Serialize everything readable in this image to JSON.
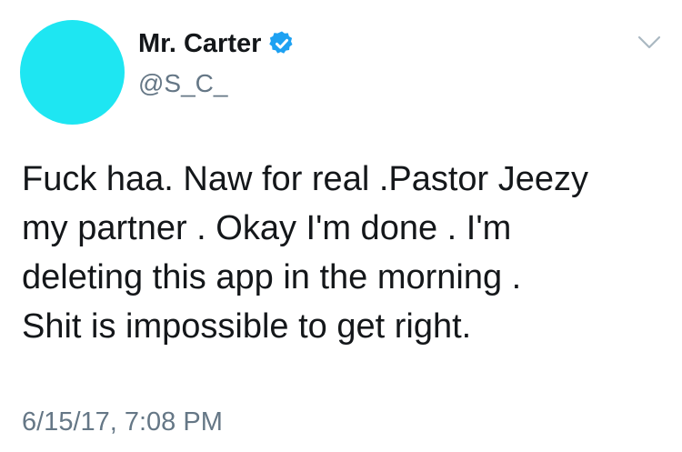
{
  "author": {
    "display_name": "Mr. Carter",
    "handle": "@S_C_",
    "verified": true,
    "avatar_color": "#1ee6f2"
  },
  "tweet": {
    "text": "Fuck haa. Naw for real .Pastor Jeezy\nmy partner . Okay I'm done . I'm\ndeleting this app in the morning .\nShit is impossible to get right.",
    "timestamp": "6/15/17, 7:08 PM"
  },
  "icons": {
    "verified": "verified-badge-icon",
    "menu": "chevron-down-icon"
  },
  "colors": {
    "verified_blue": "#1da1f2",
    "secondary_text": "#657786",
    "primary_text": "#14171a"
  }
}
